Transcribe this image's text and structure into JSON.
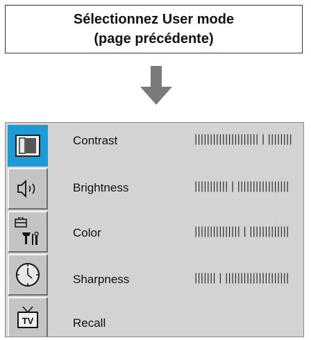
{
  "instruction": {
    "line1": "Sélectionnez User mode",
    "line2": "(page précédente)"
  },
  "menu": {
    "items": [
      {
        "label": "Contrast",
        "icon": "picture-icon",
        "bar": "||||||||||||||||||||| | ||||||||"
      },
      {
        "label": "Brightness",
        "icon": "sound-icon",
        "bar": "||||||||||| | |||||||||||||||||"
      },
      {
        "label": "Color",
        "icon": "tools-icon",
        "bar": "||||||||||||||| | |||||||||||||"
      },
      {
        "label": "Sharpness",
        "icon": "clock-icon",
        "bar": "||||||| | |||||||||||||||||||||"
      },
      {
        "label": "Recall",
        "icon": "tv-icon"
      }
    ],
    "active_index": 0
  },
  "colors": {
    "highlight": "#1e9bd7",
    "panel": "#d3d3d3",
    "arrow": "#7a7a7a"
  }
}
